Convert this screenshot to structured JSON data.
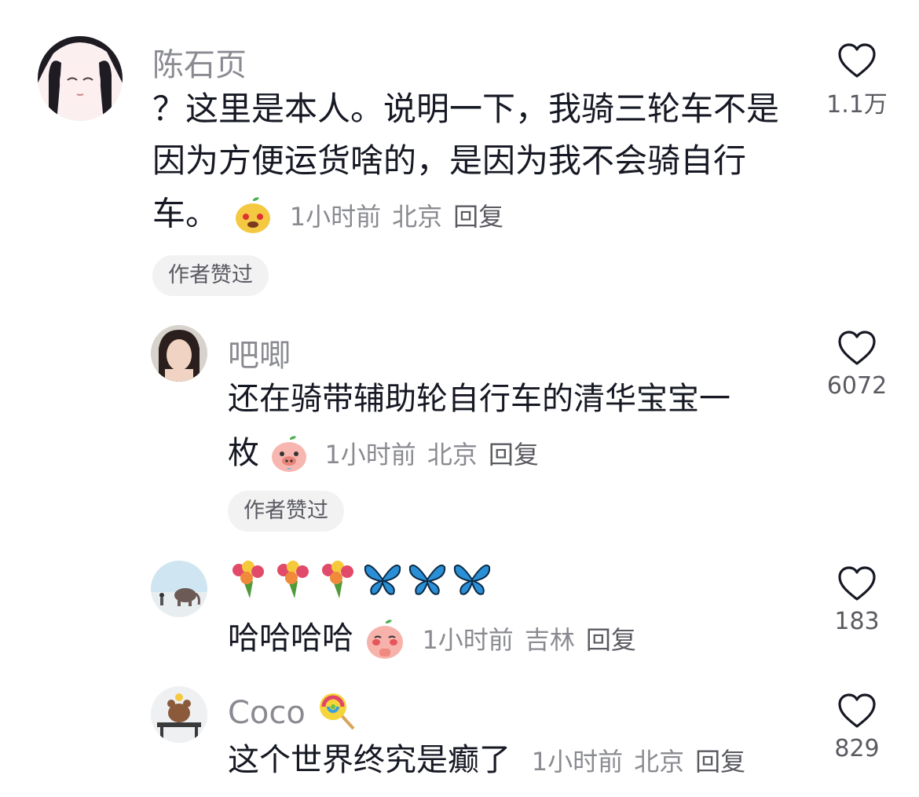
{
  "comments": [
    {
      "username": "陈石页",
      "content_lines": [
        "？这里是本人。说明一下，我骑三轮车不是",
        "因为方便运货啥的，是因为我不会骑自行",
        "车。"
      ],
      "time": "1小时前",
      "location": "北京",
      "reply": "回复",
      "likes": "1.1万",
      "tag": "作者赞过",
      "emoji": "happy-face-emoji"
    },
    {
      "username": "吧唧",
      "content_lines": [
        "还在骑带辅助轮自行车的清华宝宝一",
        "枚"
      ],
      "time": "1小时前",
      "location": "北京",
      "reply": "回复",
      "likes": "6072",
      "tag": "作者赞过",
      "emoji": "pig-face-emoji"
    },
    {
      "username_icons": [
        "rose-bouquet-icon",
        "rose-bouquet-icon",
        "rose-bouquet-icon",
        "butterfly-icon",
        "butterfly-icon",
        "butterfly-icon"
      ],
      "content_lines": [
        "哈哈哈哈"
      ],
      "time": "1小时前",
      "location": "吉林",
      "reply": "回复",
      "likes": "183",
      "emoji": "pleading-face-emoji"
    },
    {
      "username": "Coco",
      "username_icon": "lollipop-icon",
      "content_lines": [
        "这个世界终究是癫了"
      ],
      "time": "1小时前",
      "location": "北京",
      "reply": "回复",
      "likes": "829"
    }
  ],
  "colors": {
    "text": "#161823",
    "secondary": "#8a8b91",
    "tag_bg": "#f2f2f3"
  }
}
